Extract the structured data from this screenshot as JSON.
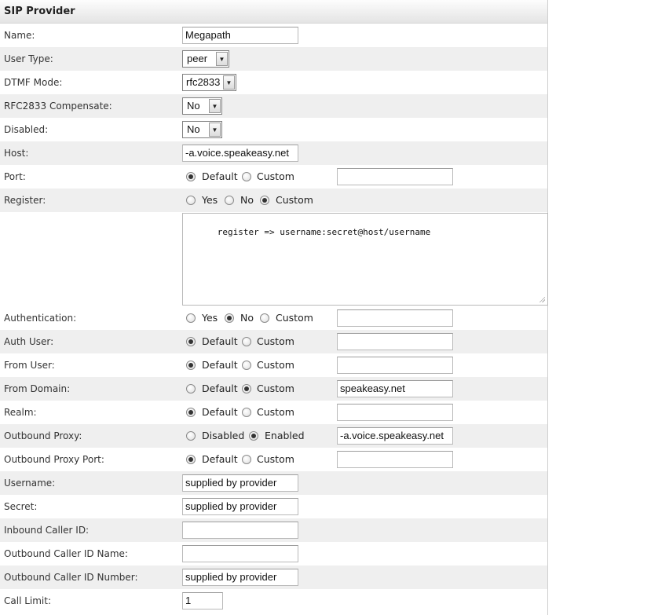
{
  "title": "SIP Provider",
  "fields": {
    "name": {
      "label": "Name:",
      "value": "Megapath"
    },
    "user_type": {
      "label": "User Type:",
      "value": "peer"
    },
    "dtmf_mode": {
      "label": "DTMF Mode:",
      "value": "rfc2833"
    },
    "rfc2833_compensate": {
      "label": "RFC2833 Compensate:",
      "value": "No"
    },
    "disabled": {
      "label": "Disabled:",
      "value": "No"
    },
    "host": {
      "label": "Host:",
      "value": "-a.voice.speakeasy.net"
    },
    "port": {
      "label": "Port:",
      "opt1": "Default",
      "opt2": "Custom",
      "selected": "Default",
      "value": ""
    },
    "register": {
      "label": "Register:",
      "opt1": "Yes",
      "opt2": "No",
      "opt3": "Custom",
      "selected": "Custom",
      "text": "register => username:secret@host/username"
    },
    "authentication": {
      "label": "Authentication:",
      "opt1": "Yes",
      "opt2": "No",
      "opt3": "Custom",
      "selected": "No",
      "value": ""
    },
    "auth_user": {
      "label": "Auth User:",
      "opt1": "Default",
      "opt2": "Custom",
      "selected": "Default",
      "value": ""
    },
    "from_user": {
      "label": "From User:",
      "opt1": "Default",
      "opt2": "Custom",
      "selected": "Default",
      "value": ""
    },
    "from_domain": {
      "label": "From Domain:",
      "opt1": "Default",
      "opt2": "Custom",
      "selected": "Custom",
      "value": "speakeasy.net"
    },
    "realm": {
      "label": "Realm:",
      "opt1": "Default",
      "opt2": "Custom",
      "selected": "Default",
      "value": ""
    },
    "outbound_proxy": {
      "label": "Outbound Proxy:",
      "opt1": "Disabled",
      "opt2": "Enabled",
      "selected": "Enabled",
      "value": "-a.voice.speakeasy.net"
    },
    "outbound_proxy_port": {
      "label": "Outbound Proxy Port:",
      "opt1": "Default",
      "opt2": "Custom",
      "selected": "Default",
      "value": ""
    },
    "username": {
      "label": "Username:",
      "value": "supplied by provider"
    },
    "secret": {
      "label": "Secret:",
      "value": "supplied by provider"
    },
    "inbound_caller_id": {
      "label": "Inbound Caller ID:",
      "value": ""
    },
    "outbound_caller_id_name": {
      "label": "Outbound Caller ID Name:",
      "value": ""
    },
    "outbound_caller_id_number": {
      "label": "Outbound Caller ID Number:",
      "value": "supplied by provider"
    },
    "call_limit": {
      "label": "Call Limit:",
      "value": "1"
    }
  }
}
